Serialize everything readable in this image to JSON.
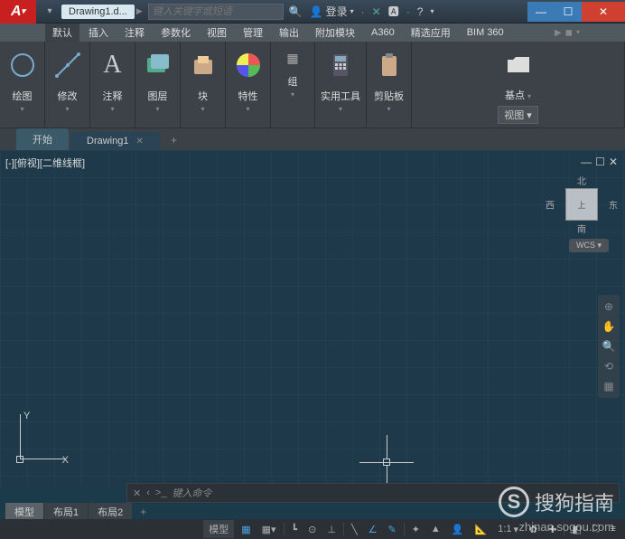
{
  "app": {
    "icon_letter": "A",
    "doc_title": "Drawing1.d..."
  },
  "search": {
    "placeholder": "键入关键字或短语"
  },
  "title": {
    "login": "登录",
    "help_glyph": "?"
  },
  "win": {
    "min": "—",
    "max": "☐",
    "close": "✕"
  },
  "menu": {
    "items": [
      "默认",
      "插入",
      "注释",
      "参数化",
      "视图",
      "管理",
      "输出",
      "附加模块",
      "A360",
      "精选应用",
      "BIM 360"
    ],
    "extras": [
      "▶",
      "◼"
    ]
  },
  "ribbon": {
    "panels": [
      {
        "label": "绘图"
      },
      {
        "label": "修改"
      },
      {
        "label": "注释"
      },
      {
        "label": "图层"
      },
      {
        "label": "块"
      },
      {
        "label": "特性"
      },
      {
        "label": "组"
      },
      {
        "label": "实用工具"
      },
      {
        "label": "剪贴板"
      },
      {
        "label": "基点"
      }
    ],
    "sub": "视图 ▾"
  },
  "filetabs": {
    "start": "开始",
    "active": "Drawing1",
    "add": "+"
  },
  "viewport": {
    "label": "[-][俯视][二维线框]",
    "controls": {
      "min": "—",
      "max": "☐",
      "close": "✕"
    }
  },
  "ucs": {
    "y": "Y",
    "x": "X"
  },
  "viewcube": {
    "face": "上",
    "n": "北",
    "s": "南",
    "e": "东",
    "w": "西",
    "wcs": "WCS ▾"
  },
  "cmd": {
    "placeholder": "键入命令",
    "x_icon": "✕",
    "chevron": "‹",
    "prompt": ">_"
  },
  "layouts": {
    "model": "模型",
    "l1": "布局1",
    "l2": "布局2",
    "add": "+"
  },
  "status": {
    "model": "模型",
    "scale": "1:1",
    "items": [
      "▦",
      "▦▾",
      "┗",
      "⊙",
      "⊥",
      "╲",
      "∠",
      "✎",
      "✦",
      "▲",
      "👤",
      "📐",
      "✚"
    ]
  },
  "watermark": {
    "text": "搜狗指南",
    "icon": "S",
    "url": "zhinan.sogou.com"
  }
}
